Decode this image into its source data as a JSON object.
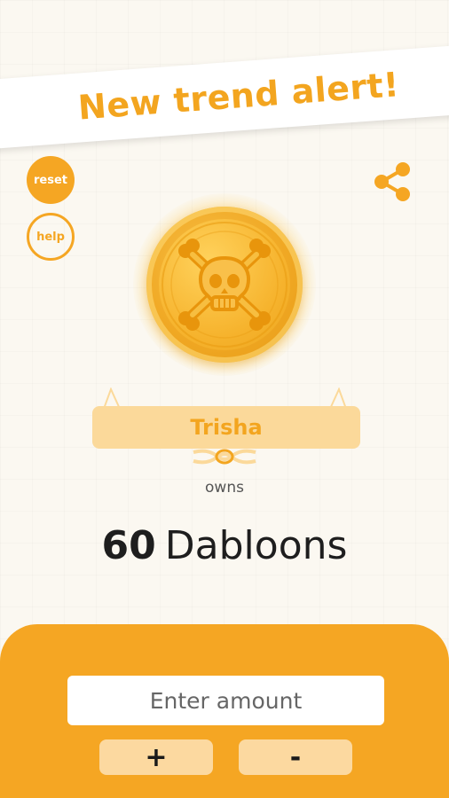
{
  "banner": {
    "text": "New trend alert!"
  },
  "controls": {
    "reset_label": "reset",
    "help_label": "help"
  },
  "icons": {
    "share": "share-icon",
    "coin": "skull-crossbones-coin-icon"
  },
  "owner": {
    "name": "Trisha",
    "owns_label": "owns"
  },
  "balance": {
    "amount": "60",
    "unit": "Dabloons"
  },
  "input": {
    "placeholder": "Enter amount",
    "value": ""
  },
  "buttons": {
    "plus": "+",
    "minus": "-"
  },
  "colors": {
    "accent": "#f5a623",
    "ribbon": "#fbd99a",
    "background": "#fbf8f1",
    "step_button": "#fcd9a0"
  }
}
